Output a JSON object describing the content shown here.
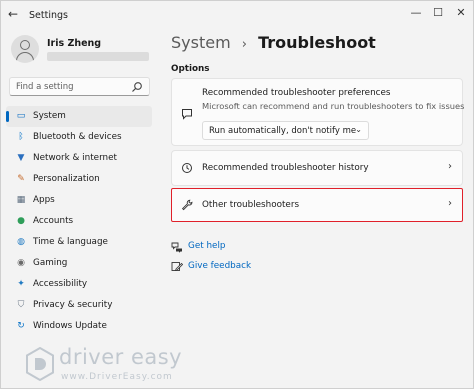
{
  "window": {
    "back_glyph": "←",
    "title": "Settings",
    "controls": {
      "minimize": "—",
      "maximize": "☐",
      "close": "✕"
    }
  },
  "profile": {
    "name": "Iris Zheng"
  },
  "search": {
    "placeholder": "Find a setting"
  },
  "sidebar": {
    "items": [
      {
        "label": "System",
        "icon": "monitor-icon",
        "glyph": "▭",
        "color": "#0067c0",
        "active": true
      },
      {
        "label": "Bluetooth & devices",
        "icon": "bluetooth-icon",
        "glyph": "ᛒ",
        "color": "#0a74c8",
        "active": false
      },
      {
        "label": "Network & internet",
        "icon": "wifi-icon",
        "glyph": "▼",
        "color": "#2b6fbf",
        "active": false
      },
      {
        "label": "Personalization",
        "icon": "brush-icon",
        "glyph": "✎",
        "color": "#c56a2b",
        "active": false
      },
      {
        "label": "Apps",
        "icon": "apps-icon",
        "glyph": "▦",
        "color": "#5a6b7d",
        "active": false
      },
      {
        "label": "Accounts",
        "icon": "accounts-icon",
        "glyph": "●",
        "color": "#2f9e5a",
        "active": false
      },
      {
        "label": "Time & language",
        "icon": "globe-icon",
        "glyph": "◍",
        "color": "#1f7ac2",
        "active": false
      },
      {
        "label": "Gaming",
        "icon": "gaming-icon",
        "glyph": "◉",
        "color": "#6a6a6a",
        "active": false
      },
      {
        "label": "Accessibility",
        "icon": "accessibility-icon",
        "glyph": "✦",
        "color": "#1f7ac2",
        "active": false
      },
      {
        "label": "Privacy & security",
        "icon": "shield-icon",
        "glyph": "⛉",
        "color": "#6d7a88",
        "active": false
      },
      {
        "label": "Windows Update",
        "icon": "update-icon",
        "glyph": "↻",
        "color": "#0a74c8",
        "active": false
      }
    ]
  },
  "main": {
    "breadcrumb_parent": "System",
    "breadcrumb_sep": "›",
    "breadcrumb_current": "Troubleshoot",
    "section_title": "Options",
    "prefs_card": {
      "title": "Recommended troubleshooter preferences",
      "description": "Microsoft can recommend and run troubleshooters to fix issues",
      "dropdown_value": "Run automatically, don't notify me",
      "dropdown_chevron": "⌄"
    },
    "history_card": {
      "title": "Recommended troubleshooter history",
      "chevron": "›"
    },
    "other_card": {
      "title": "Other troubleshooters",
      "chevron": "›",
      "highlight_color": "#e0202a"
    },
    "links": {
      "help": "Get help",
      "feedback": "Give feedback"
    }
  },
  "watermark": {
    "name": "driver easy",
    "url": "www.DriverEasy.com"
  },
  "colors": {
    "accent": "#0067c0",
    "background": "#f3f3f3",
    "card": "#fbfbfb"
  }
}
